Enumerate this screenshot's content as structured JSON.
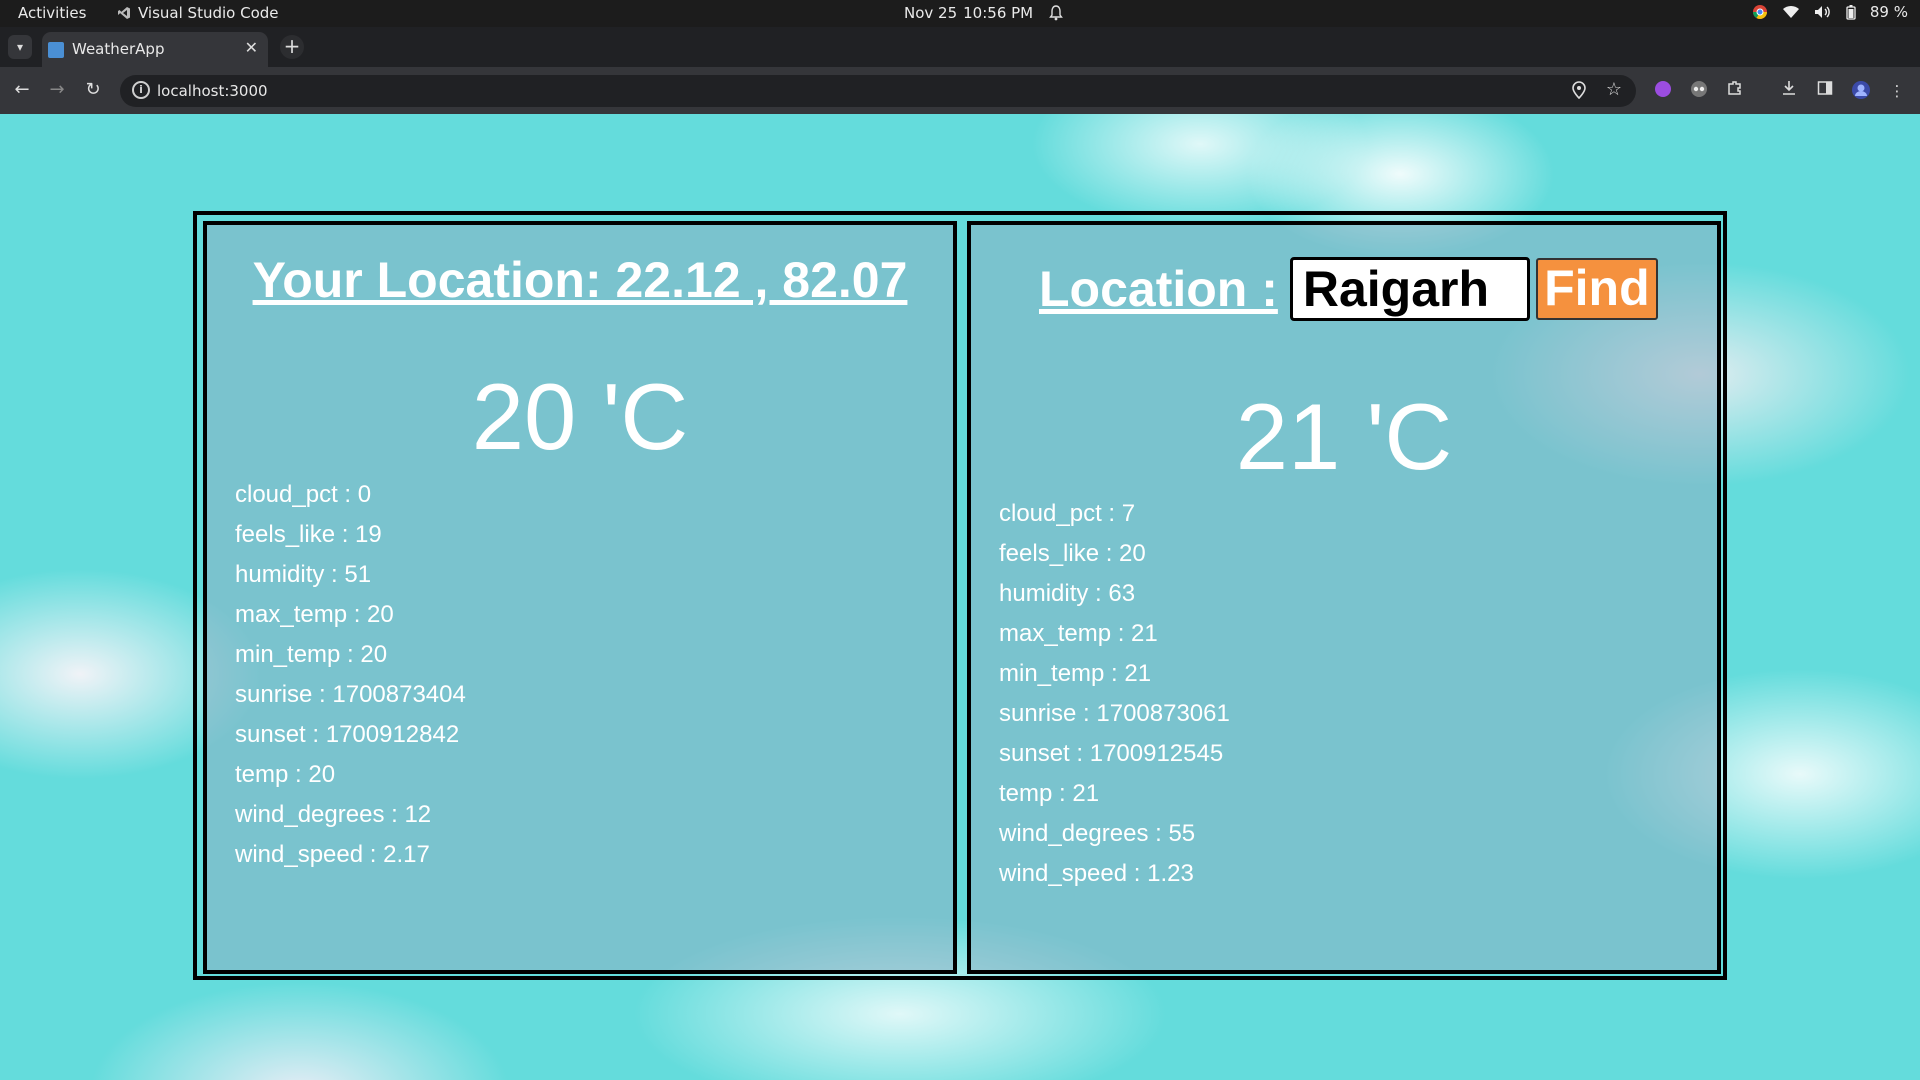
{
  "os_bar": {
    "activities": "Activities",
    "app_name": "Visual Studio Code",
    "date": "Nov 25",
    "time": "10:56 PM",
    "battery": "89 %"
  },
  "browser": {
    "tab_title": "WeatherApp",
    "url": "localhost:3000"
  },
  "left_panel": {
    "title": "Your Location: 22.12 , 82.07",
    "temp": "20 'C",
    "stats": [
      "cloud_pct : 0",
      "feels_like : 19",
      "humidity : 51",
      "max_temp : 20",
      "min_temp : 20",
      "sunrise : 1700873404",
      "sunset : 1700912842",
      "temp : 20",
      "wind_degrees : 12",
      "wind_speed : 2.17"
    ]
  },
  "right_panel": {
    "label": "Location :",
    "input_value": "Raigarh",
    "find_label": "Find",
    "temp": "21 'C",
    "stats": [
      "cloud_pct : 7",
      "feels_like : 20",
      "humidity : 63",
      "max_temp : 21",
      "min_temp : 21",
      "sunrise : 1700873061",
      "sunset : 1700912545",
      "temp : 21",
      "wind_degrees : 55",
      "wind_speed : 1.23"
    ]
  },
  "colors": {
    "sky": "#64dcdc",
    "find_button": "#f5913e",
    "panel_border": "#000000"
  },
  "icons": {
    "vscode": "vscode-icon",
    "notification": "bell-icon",
    "chrome": "chrome-icon",
    "wifi": "wifi-icon",
    "volume": "volume-icon",
    "battery": "battery-icon"
  }
}
